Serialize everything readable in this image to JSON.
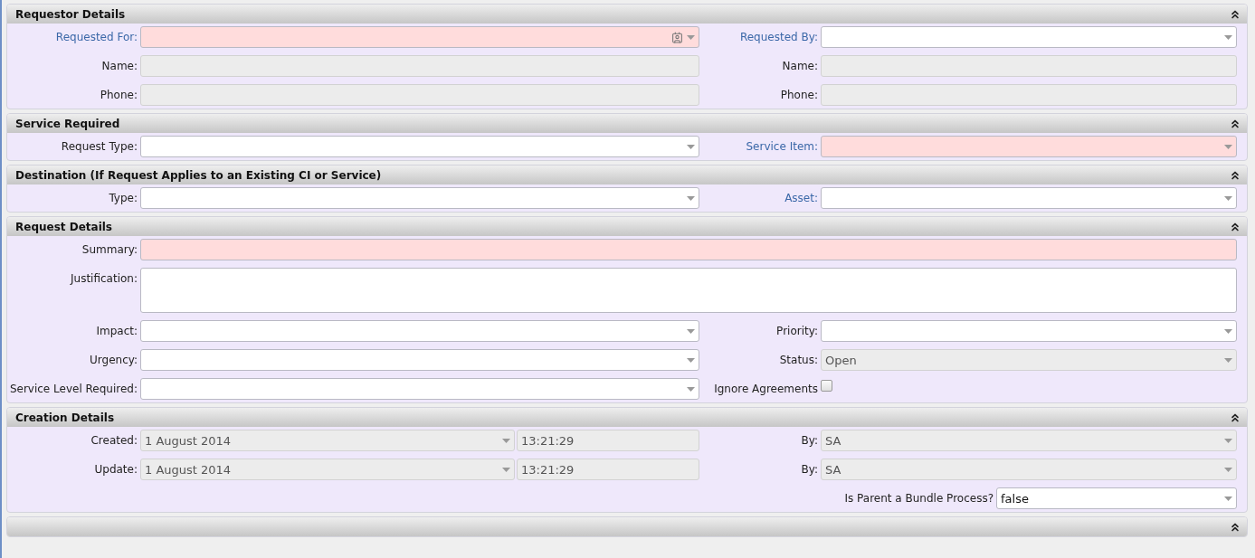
{
  "sections": [
    {
      "title": "Requestor Details",
      "expanded": true,
      "rows": [
        {
          "kind": "pair",
          "fields": [
            {
              "label": "Requested For:",
              "link": true,
              "kind": "lookup",
              "required": true
            },
            {
              "label": "Requested By:",
              "link": true,
              "kind": "dropdown",
              "required": false,
              "disabled": false
            }
          ]
        },
        {
          "kind": "pair",
          "fields": [
            {
              "label": "Name:",
              "link": false,
              "kind": "text",
              "required": false,
              "disabled": true
            },
            {
              "label": "Name:",
              "link": false,
              "kind": "text",
              "required": false,
              "disabled": true
            }
          ]
        },
        {
          "kind": "pair",
          "fields": [
            {
              "label": "Phone:",
              "link": false,
              "kind": "text",
              "required": false,
              "disabled": true
            },
            {
              "label": "Phone:",
              "link": false,
              "kind": "text",
              "required": false,
              "disabled": true
            }
          ]
        }
      ]
    },
    {
      "title": "Service Required",
      "expanded": true,
      "rows": [
        {
          "kind": "pair",
          "fields": [
            {
              "label": "Request Type:",
              "link": false,
              "kind": "dropdown",
              "required": false,
              "disabled": false
            },
            {
              "label": "Service Item:",
              "link": true,
              "kind": "dropdown",
              "required": true
            }
          ]
        }
      ]
    },
    {
      "title": "Destination (If Request Applies to an Existing CI or Service)",
      "expanded": true,
      "rows": [
        {
          "kind": "pair",
          "fields": [
            {
              "label": "Type:",
              "link": false,
              "kind": "dropdown",
              "required": false,
              "disabled": false
            },
            {
              "label": "Asset:",
              "link": true,
              "kind": "dropdown",
              "required": false,
              "disabled": false
            }
          ]
        }
      ]
    },
    {
      "title": "Request Details",
      "expanded": true,
      "rows": [
        {
          "kind": "wide",
          "fields": [
            {
              "label": "Summary:",
              "link": false,
              "kind": "text",
              "required": true
            }
          ]
        },
        {
          "kind": "wide",
          "fields": [
            {
              "label": "Justification:",
              "link": false,
              "kind": "textarea",
              "required": false,
              "disabled": false
            }
          ]
        },
        {
          "kind": "pair",
          "fields": [
            {
              "label": "Impact:",
              "link": false,
              "kind": "dropdown",
              "required": false,
              "disabled": false
            },
            {
              "label": "Priority:",
              "link": false,
              "kind": "dropdown",
              "required": false,
              "disabled": false
            }
          ]
        },
        {
          "kind": "pair",
          "fields": [
            {
              "label": "Urgency:",
              "link": false,
              "kind": "dropdown",
              "required": false,
              "disabled": false
            },
            {
              "label": "Status:",
              "link": false,
              "kind": "dropdown",
              "required": false,
              "disabled": true,
              "value": "Open"
            }
          ]
        },
        {
          "kind": "pair",
          "fields": [
            {
              "label": "Service Level Required:",
              "link": false,
              "kind": "dropdown",
              "required": false,
              "disabled": false
            },
            {
              "label": "Ignore Agreements",
              "kind": "checkbox",
              "checked": false
            }
          ]
        }
      ]
    },
    {
      "title": "Creation Details",
      "expanded": true,
      "rows": [
        {
          "kind": "pair",
          "fields": [
            {
              "label": "Created:",
              "link": false,
              "kind": "datetime",
              "required": false,
              "disabled": true,
              "value": "1 August 2014",
              "time": "13:21:29"
            },
            {
              "label": "By:",
              "link": false,
              "kind": "dropdown",
              "required": false,
              "disabled": true,
              "value": "SA"
            }
          ]
        },
        {
          "kind": "pair",
          "fields": [
            {
              "label": "Update:",
              "link": false,
              "kind": "datetime",
              "required": false,
              "disabled": true,
              "value": "1 August 2014",
              "time": "13:21:29"
            },
            {
              "label": "By:",
              "link": false,
              "kind": "dropdown",
              "required": false,
              "disabled": true,
              "value": "SA"
            }
          ]
        },
        {
          "kind": "end",
          "fields": [
            {
              "label": "Is Parent a Bundle Process?",
              "link": false,
              "kind": "dropdown",
              "required": false,
              "disabled": false,
              "value": "false"
            }
          ]
        }
      ]
    },
    {
      "expanded": true
    }
  ]
}
